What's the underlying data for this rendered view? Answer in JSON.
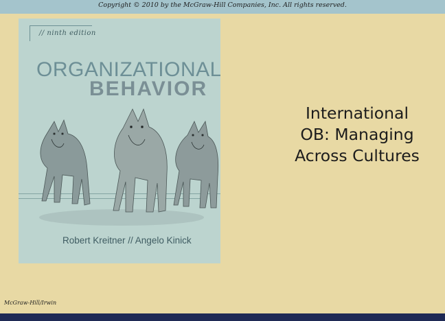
{
  "header": {
    "copyright": "Copyright © 2010 by the McGraw-Hill Companies, Inc. All rights reserved."
  },
  "cover": {
    "edition": "// ninth edition",
    "title_line1": "ORGANIZATIONAL",
    "title_line2": "BEHAVIOR",
    "authors": "Robert Kreitner // Angelo Kinick",
    "image": "three-wolves-illustration"
  },
  "slide": {
    "heading_lines": [
      "International",
      "OB:  Managing",
      "Across Cultures"
    ]
  },
  "footer": {
    "publisher": "McGraw-Hill/Irwin"
  },
  "colors": {
    "background": "#e8d9a4",
    "top_band": "#a4c4cc",
    "bottom_band": "#1f2a55",
    "cover_bg": "#bcd4cf",
    "title_color": "#6d8f96"
  }
}
